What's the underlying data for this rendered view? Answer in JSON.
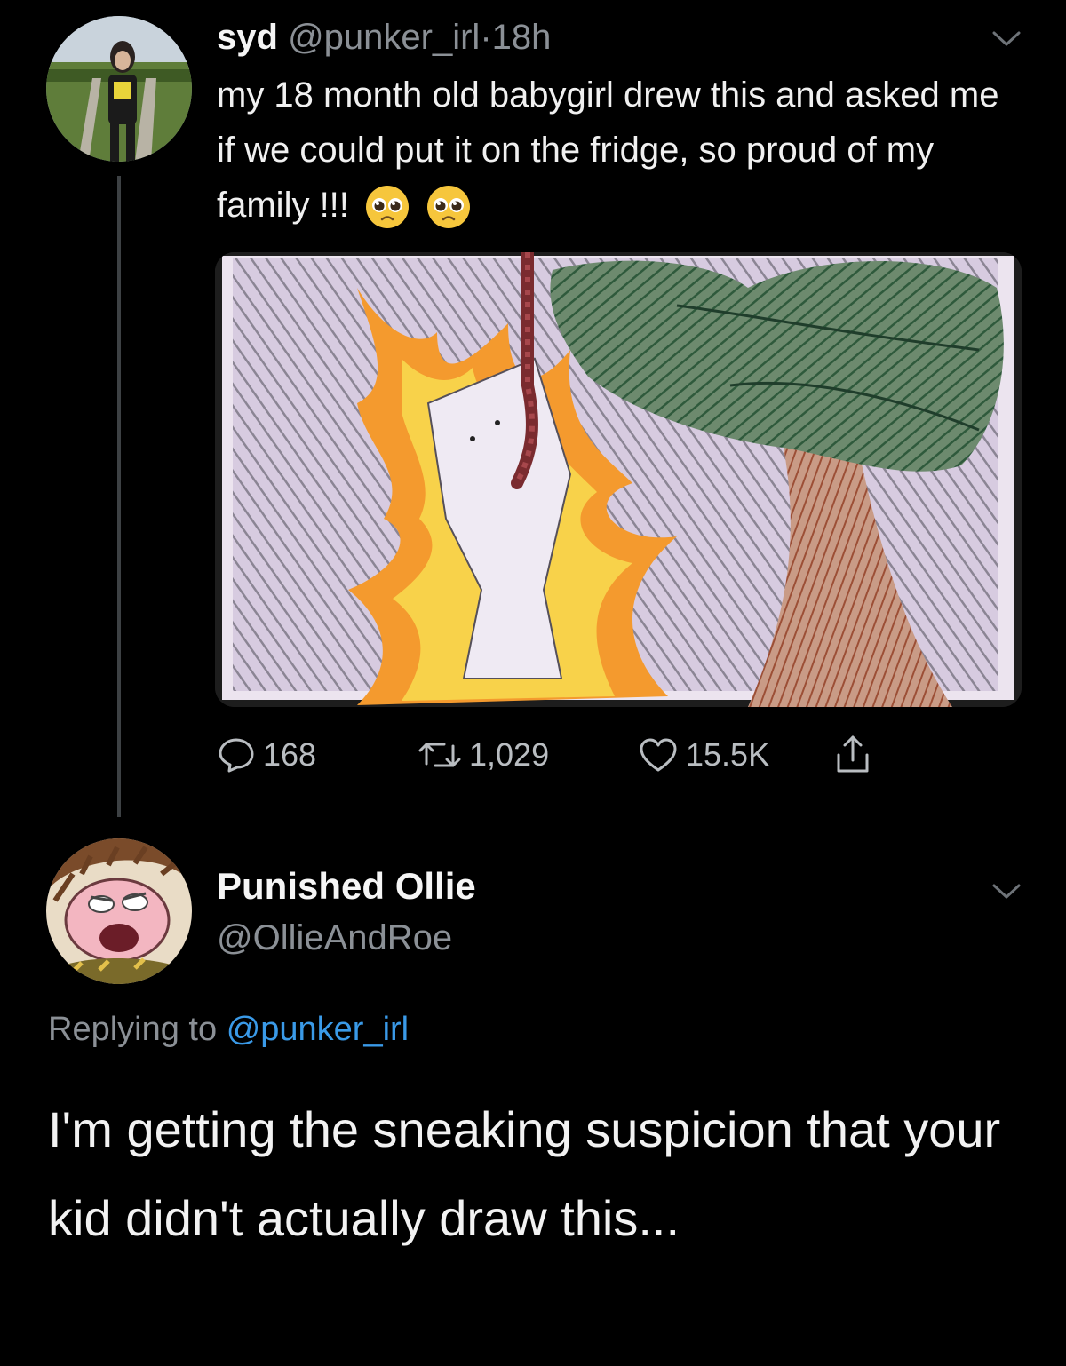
{
  "tweet": {
    "name": "syd",
    "handle": "@punker_irl",
    "separator": "·",
    "time": "18h",
    "text": "my 18 month old babygirl drew this and asked me if we could put it on the fridge, so proud of my family !!!",
    "emoji_icons": [
      "pleading-face-icon",
      "pleading-face-icon"
    ],
    "image_icon": "crayon-drawing-image",
    "actions": {
      "replies": "168",
      "retweets": "1,029",
      "likes": "15.5K"
    }
  },
  "reply": {
    "name": "Punished Ollie",
    "handle": "@OllieAndRoe",
    "replying_prefix": "Replying to",
    "replying_to": "@punker_irl",
    "text": "I'm getting the sneaking suspicion that your kid didn't actually draw this..."
  },
  "colors": {
    "background": "#000000",
    "secondary_text": "#8b9096",
    "link": "#3a9ae8",
    "thread_line": "#3d4144"
  }
}
